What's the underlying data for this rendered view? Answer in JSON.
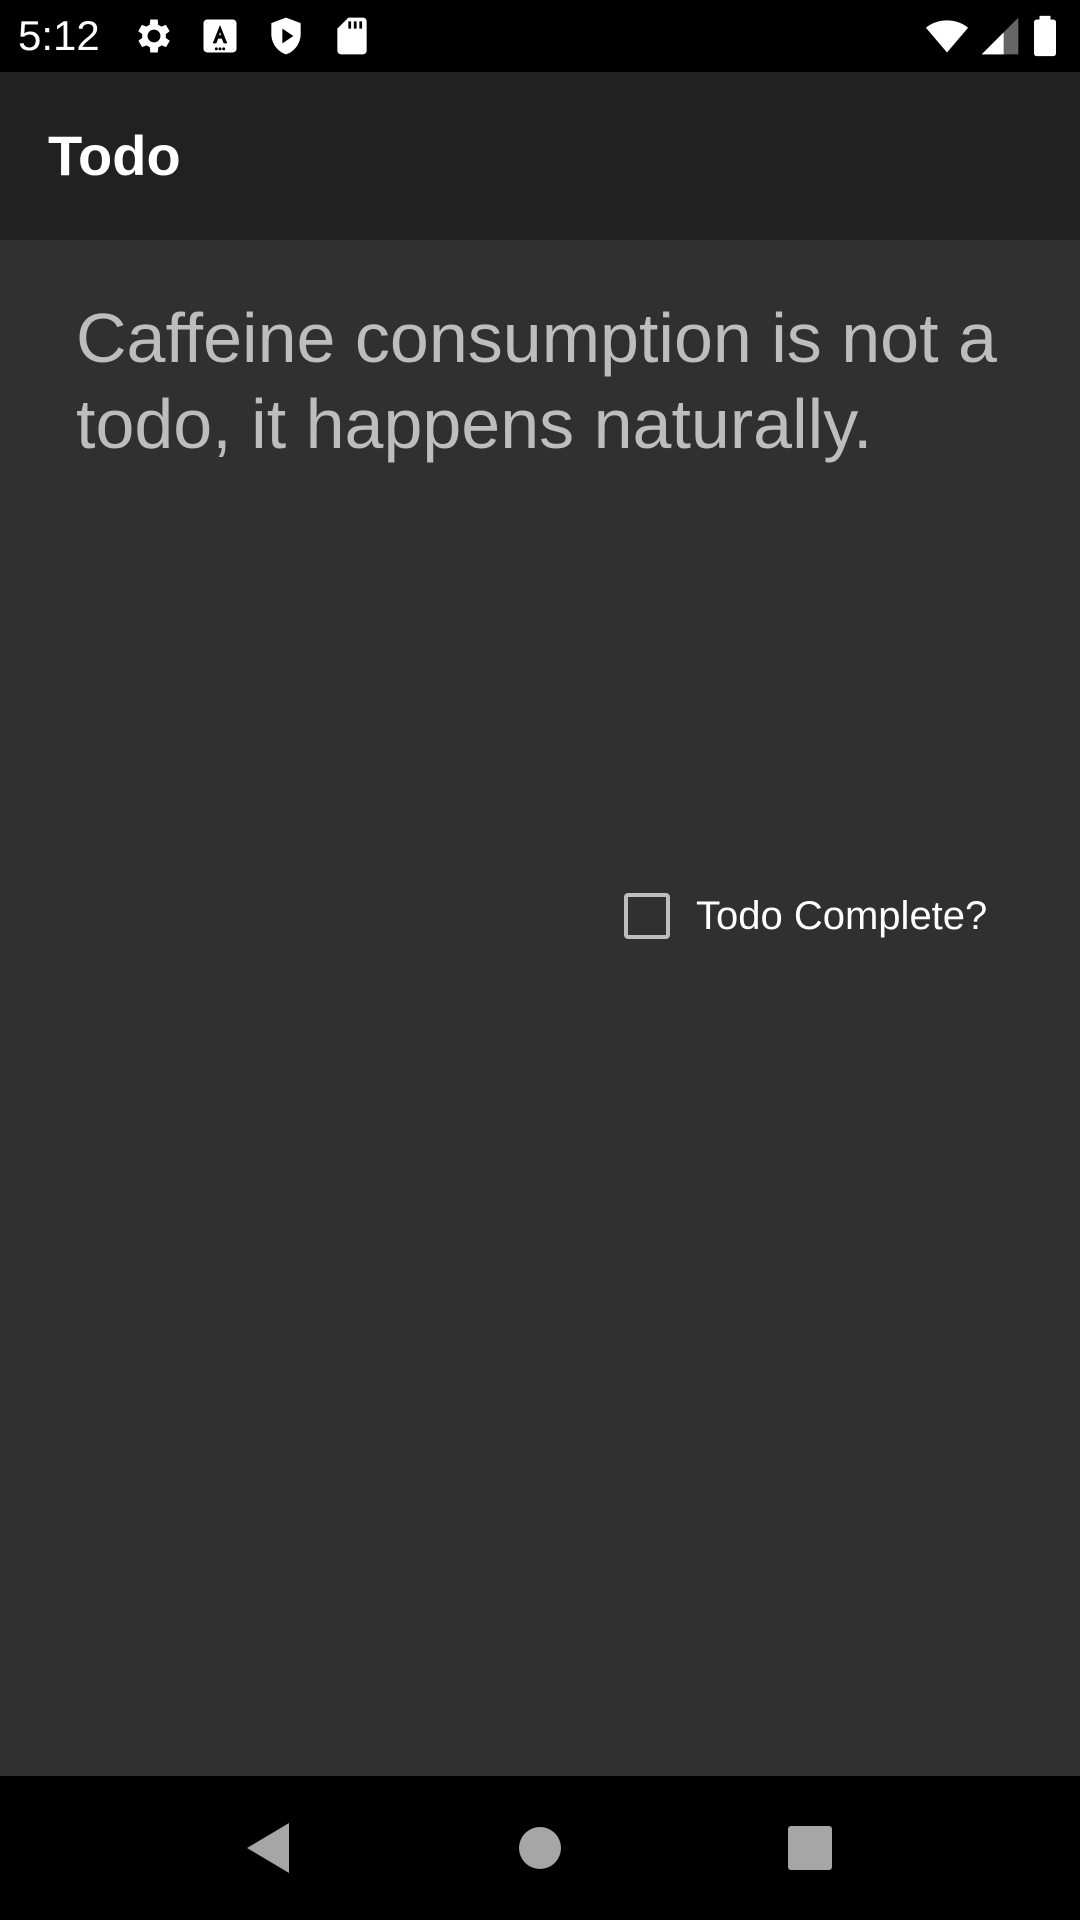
{
  "status_bar": {
    "time": "5:12",
    "icons_left": [
      "gear-icon",
      "font-a-icon",
      "play-shield-icon",
      "sd-card-icon"
    ],
    "icons_right": [
      "wifi-icon",
      "cell-signal-icon",
      "battery-icon"
    ]
  },
  "app_bar": {
    "title": "Todo"
  },
  "todo": {
    "text": "Caffeine consumption is not a todo, it happens naturally.",
    "complete_label": "Todo Complete?",
    "complete_checked": false
  },
  "nav_bar": {
    "buttons": [
      "back-icon",
      "home-icon",
      "recents-icon"
    ]
  },
  "colors": {
    "background": "#303030",
    "app_bar": "#212121",
    "status_bar": "#000000",
    "text_secondary": "#bdbdbd",
    "text_primary": "#ffffff"
  }
}
